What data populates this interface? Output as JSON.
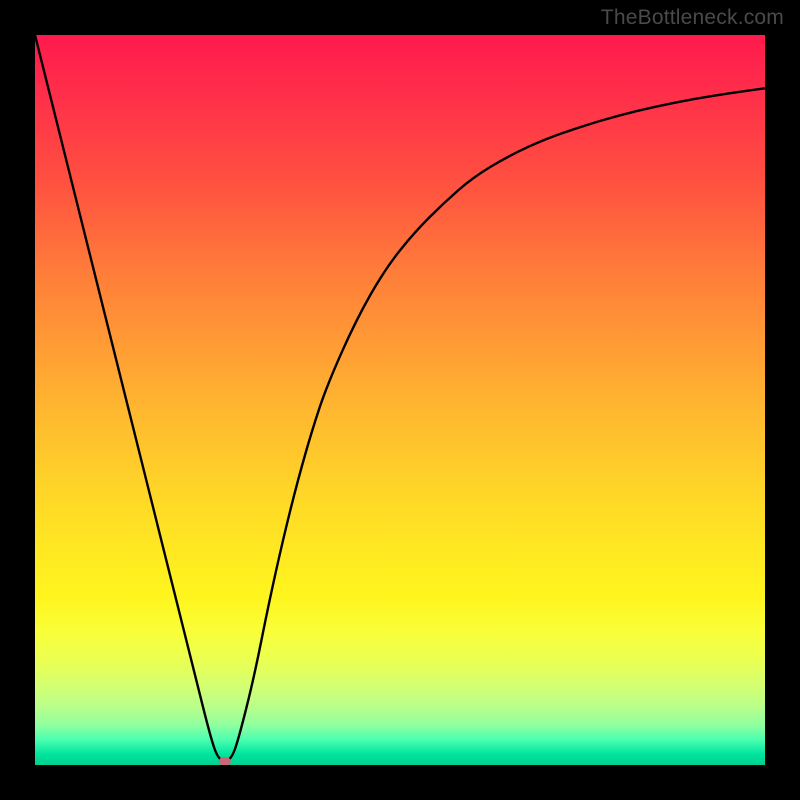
{
  "watermark": "TheBottleneck.com",
  "chart_data": {
    "type": "line",
    "title": "",
    "xlabel": "",
    "ylabel": "",
    "xlim": [
      0,
      100
    ],
    "ylim": [
      0,
      100
    ],
    "series": [
      {
        "name": "bottleneck-curve",
        "x": [
          0,
          2,
          4,
          6,
          8,
          10,
          12,
          14,
          16,
          18,
          20,
          22,
          24,
          25,
          26,
          27,
          28,
          30,
          32,
          34,
          36,
          38,
          40,
          44,
          48,
          52,
          56,
          60,
          65,
          70,
          75,
          80,
          85,
          90,
          95,
          100
        ],
        "values": [
          100,
          92,
          84,
          76,
          68,
          60,
          52,
          44,
          36,
          28,
          20,
          12,
          4,
          1,
          0.5,
          1,
          4,
          12,
          22,
          31,
          39,
          46,
          52,
          61,
          68,
          73,
          77,
          80.5,
          83.5,
          85.8,
          87.5,
          89,
          90.2,
          91.2,
          92,
          92.7
        ]
      }
    ],
    "annotations": [
      {
        "name": "minimum-marker",
        "x": 26,
        "y": 0.5,
        "shape": "ellipse",
        "color": "#cc6677"
      }
    ],
    "grid": false,
    "legend": false
  }
}
